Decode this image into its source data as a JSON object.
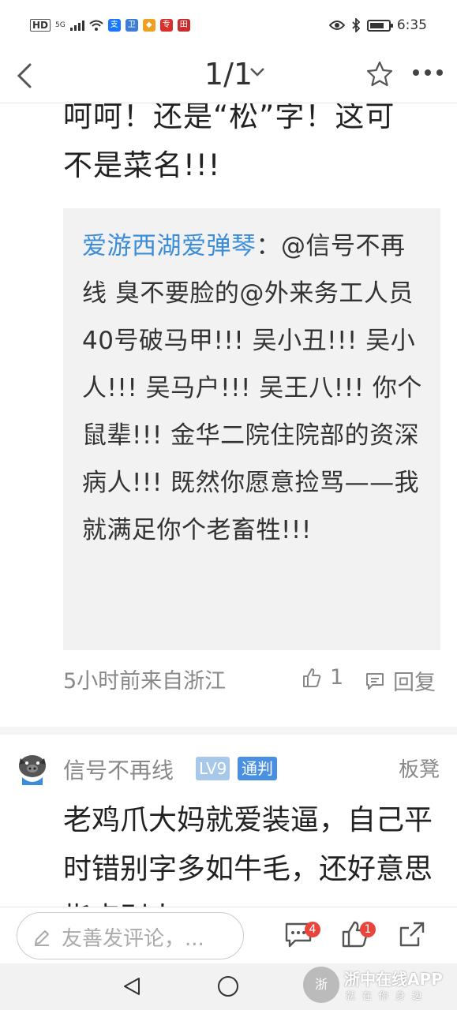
{
  "status_bar": {
    "hd_label": "HD",
    "network_label": "5G",
    "time": "6:35",
    "apps": [
      {
        "glyph": "支",
        "color": "#1677ff"
      },
      {
        "glyph": "卫",
        "color": "#3c7dd6"
      },
      {
        "glyph": "◆",
        "color": "#f0a020"
      },
      {
        "glyph": "专",
        "color": "#d9302c"
      },
      {
        "glyph": "田",
        "color": "#c82c2c"
      }
    ]
  },
  "nav": {
    "page_indicator": "1/1",
    "back_icon": "chevron-left-icon",
    "star_icon": "star-outline-icon",
    "more_icon": "more-horizontal-icon"
  },
  "post": {
    "text_line1": "呵呵！还是“松”字！这可",
    "text_line2": "不是菜名!!!",
    "quote_user": "爱游西湖爱弹琴",
    "quote_text": "：@信号不再线 臭不要脸的@外来务工人员 40号破马甲!!!  吴小丑!!!  吴小人!!!  吴马户!!!  吴王八!!!  你个鼠辈!!!  金华二院住院部的资深病人!!!  既然你愿意捡骂——我就满足你个老畜牲!!!",
    "meta_time": "5小时前来自浙江",
    "like_count": "1",
    "reply_label": "回复"
  },
  "comment": {
    "username": "信号不再线",
    "level": "LV9",
    "rank": "通判",
    "floor": "板凳",
    "text": "老鸡爪大妈就爱装逼，自己平时错别字多如牛毛，还好意思指点别人"
  },
  "bottom_bar": {
    "input_placeholder": "友善发评论，...",
    "comment_badge": "4",
    "like_badge": "1"
  },
  "watermark": {
    "logo_text": "浙",
    "title": "浙中在线APP",
    "subtitle": "就在你身边"
  },
  "colors": {
    "accent": "#3b8dd9",
    "badge": "#e8453c",
    "rank_badge": "#4a90e2",
    "level_badge": "#a8c8ea"
  }
}
